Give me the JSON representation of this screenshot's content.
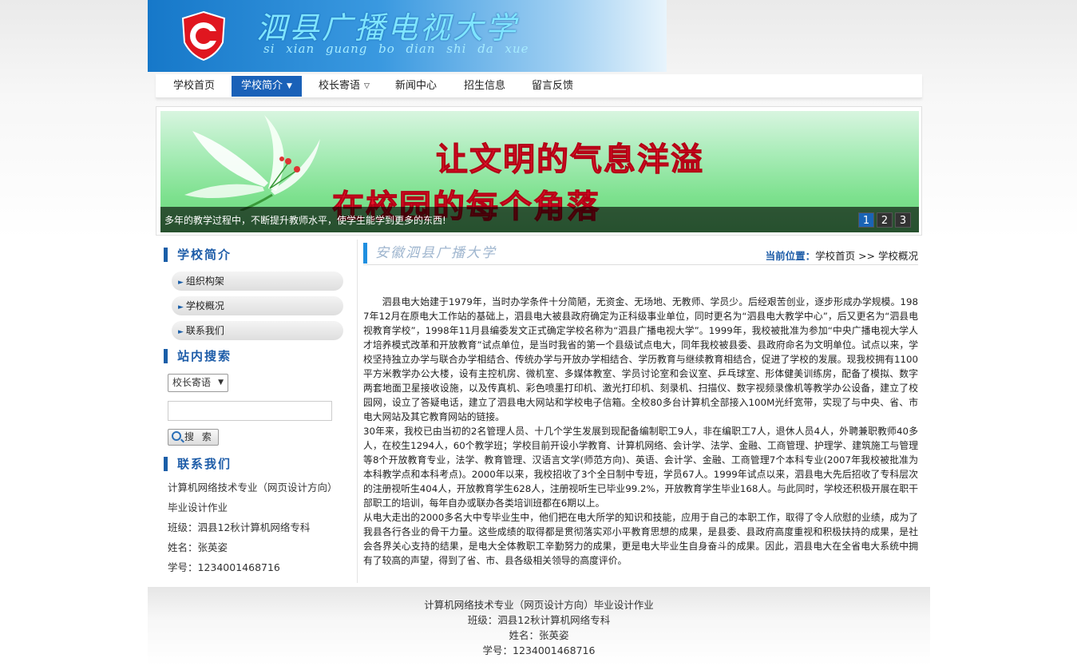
{
  "header": {
    "title": "泗县广播电视大学",
    "subtitle": "si xian guang bo dian shi da xue",
    "logo_icon": "c-logo-icon"
  },
  "nav": {
    "items": [
      {
        "label": "学校首页",
        "active": false,
        "dropdown": false
      },
      {
        "label": "学校简介",
        "active": true,
        "dropdown": true
      },
      {
        "label": "校长寄语",
        "active": false,
        "dropdown": true
      },
      {
        "label": "新闻中心",
        "active": false,
        "dropdown": false
      },
      {
        "label": "招生信息",
        "active": false,
        "dropdown": false
      },
      {
        "label": "留言反馈",
        "active": false,
        "dropdown": false
      }
    ]
  },
  "banner": {
    "slogan_line1": "让文明的气息洋溢",
    "slogan_line2": "在校园的每个角落",
    "caption": "多年的教学过程中，不断提升教师水平，使学生能学到更多的东西!",
    "pages": [
      "1",
      "2",
      "3"
    ],
    "current_page": "1"
  },
  "sidebar": {
    "intro_heading": "学校简介",
    "intro_links": [
      {
        "label": "组织构架"
      },
      {
        "label": "学校概况"
      },
      {
        "label": "联系我们"
      }
    ],
    "search_heading": "站内搜索",
    "search_select_value": "校长寄语",
    "search_input_value": "",
    "search_button_label": "搜 索",
    "contact_heading": "联系我们",
    "contact_lines": [
      "计算机网络技术专业（网页设计方向）毕业设计作业",
      "班级：泗县12秋计算机网络专科",
      "姓名：张英姿",
      "学号：1234001468716"
    ]
  },
  "content": {
    "section_title": "安徽泗县广播大学",
    "location_label": "当前位置：",
    "location_path": "学校首页 >> 学校概况",
    "paragraphs": [
      "泗县电大始建于1979年，当时办学条件十分简陋，无资金、无场地、无教师、学员少。后经艰苦创业，逐步形成办学规模。1987年12月在原电大工作站的基础上，泗县电大被县政府确定为正科级事业单位，同时更名为“泗县电大教学中心”，后又更名为“泗县电视教育学校”，1998年11月县编委发文正式确定学校名称为“泗县广播电视大学”。1999年，我校被批准为参加“中央广播电视大学人才培养模式改革和开放教育”试点单位，是当时我省的第一个县级试点电大，同年我校被县委、县政府命名为文明单位。试点以来，学校坚持独立办学与联合办学相结合、传统办学与开放办学相结合、学历教育与继续教育相结合，促进了学校的发展。现我校拥有1100平方米教学办公大楼，设有主控机房、微机室、多媒体教室、学员讨论室和会议室、乒乓球室、形体健美训练房，配备了模拟、数字两套地面卫星接收设施，以及传真机、彩色喷墨打印机、激光打印机、刻录机、扫描仪、数字视频录像机等教学办公设备，建立了校园网，设立了答疑电话，建立了泗县电大网站和学校电子信箱。全校80多台计算机全部接入100M光纤宽带，实现了与中央、省、市电大网站及其它教育网站的链接。",
      "30年来，我校已由当初的2名管理人员、十几个学生发展到现配备编制职工9人，非在编职工7人，退休人员4人，外聘兼职教师40多人，在校生1294人，60个教学班；学校目前开设小学教育、计算机网络、会计学、法学、金融、工商管理、护理学、建筑施工与管理等8个开放教育专业，法学、教育管理、汉语言文学(师范方向)、英语、会计学、金融、工商管理7个本科专业(2007年我校被批准为本科教学点和本科考点)。2000年以来，我校招收了3个全日制中专班，学员67人。1999年试点以来，泗县电大先后招收了专科层次的注册视听生404人，开放教育学生628人，注册视听生已毕业99.2%，开放教育学生毕业168人。与此同时，学校还积极开展在职干部职工的培训，每年自办或联办各类培训班都在6期以上。",
      "从电大走出的2000多名大中专毕业生中，他们把在电大所学的知识和技能，应用于自己的本职工作，取得了令人欣慰的业绩，成为了我县各行各业的骨干力量。这些成绩的取得都是贯彻落实邓小平教育思想的成果，是县委、县政府高度重视和积极扶持的成果，是社会各界关心支持的结果，是电大全体教职工辛勤努力的成果，更是电大毕业生自身奋斗的成果。因此，泗县电大在全省电大系统中拥有了较高的声望，得到了省、市、县各级相关领导的高度评价。"
    ]
  },
  "footer": {
    "lines": [
      "计算机网络技术专业（网页设计方向）毕业设计作业",
      "班级：泗县12秋计算机网络专科",
      "姓名：张英姿",
      "学号：1234001468716"
    ]
  },
  "colors": {
    "nav_active": "#1a61b8",
    "heading_blue": "#1d5ca8",
    "slogan_red": "#e8172e",
    "header_blue": "#1678c9"
  }
}
